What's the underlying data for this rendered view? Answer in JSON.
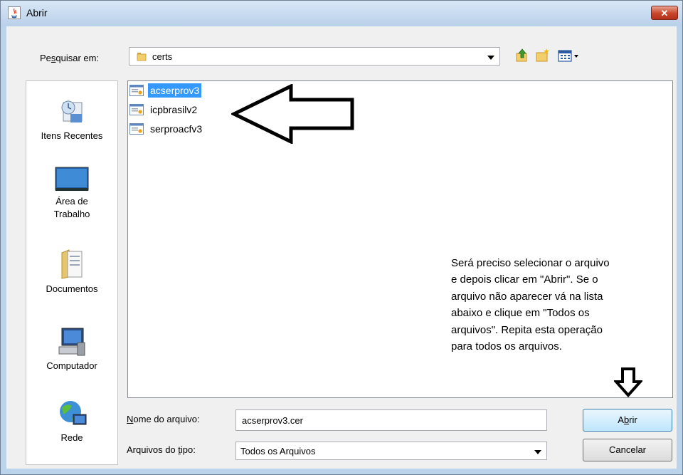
{
  "window": {
    "title": "Abrir",
    "close_label": "✕"
  },
  "lookin": {
    "label_pre": "Pe",
    "label_key": "s",
    "label_post": "quisar em:",
    "value": "certs"
  },
  "toolbar": {
    "up_icon": "up-folder-icon",
    "new_folder_icon": "new-folder-icon",
    "view_icon": "view-menu-icon"
  },
  "places": [
    {
      "label": "Itens Recentes"
    },
    {
      "label": "Área de Trabalho"
    },
    {
      "label": "Documentos"
    },
    {
      "label": "Computador"
    },
    {
      "label": "Rede"
    }
  ],
  "files": [
    {
      "name": "acserprov3",
      "selected": true
    },
    {
      "name": "icpbrasilv2",
      "selected": false
    },
    {
      "name": "serproacfv3",
      "selected": false
    }
  ],
  "annotation": {
    "lines": [
      "Será preciso selecionar o arquivo",
      "e depois clicar em \"Abrir\". Se o",
      "arquivo não aparecer vá na lista",
      "abaixo e clique em \"Todos os",
      "arquivos\". Repita esta operação",
      "para todos os arquivos."
    ]
  },
  "filename": {
    "label_key": "N",
    "label_post": "ome do arquivo:",
    "value": "acserprov3.cer"
  },
  "filetype": {
    "label_pre": "Arquivos do ",
    "label_key": "t",
    "label_post": "ipo:",
    "value": "Todos os Arquivos"
  },
  "buttons": {
    "open_pre": "A",
    "open_key": "b",
    "open_post": "rir",
    "cancel": "Cancelar"
  },
  "colors": {
    "selection": "#3399ff",
    "close_button": "#c9452a",
    "title_bar": "#bcd3ec"
  }
}
